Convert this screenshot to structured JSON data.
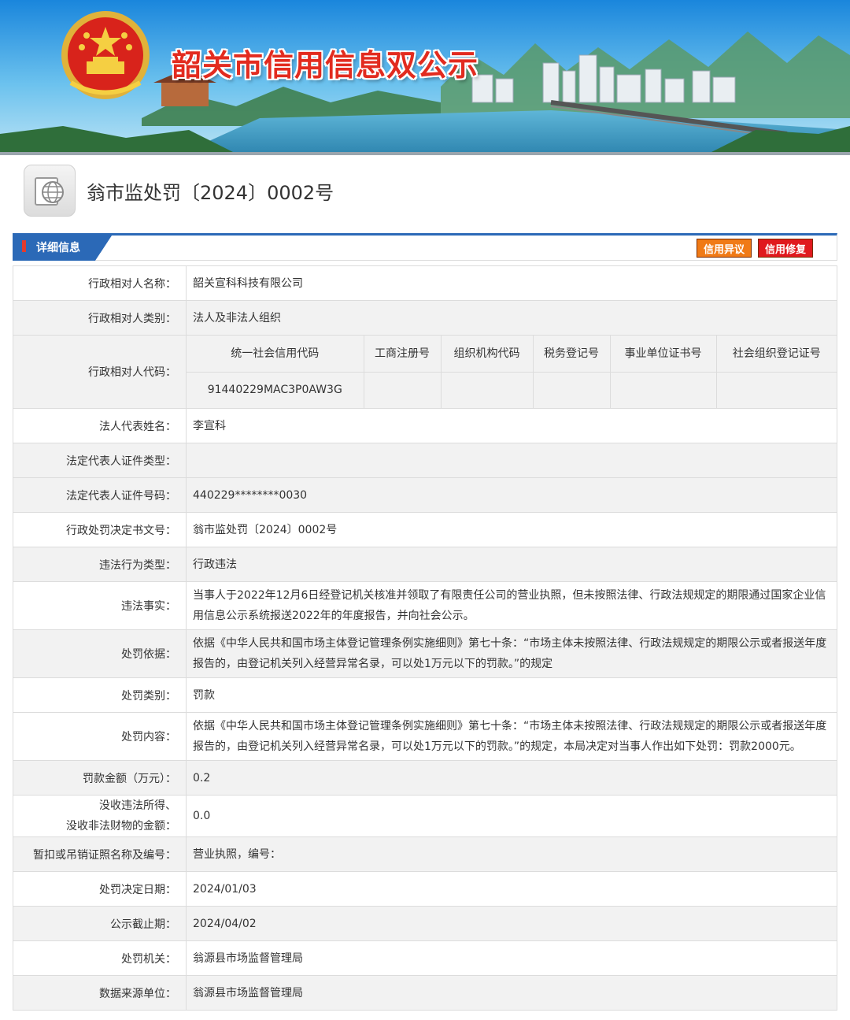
{
  "banner": {
    "title": "韶关市信用信息双公示"
  },
  "doc": {
    "title": "翁市监处罚〔2024〕0002号"
  },
  "section": {
    "tab_label": "详细信息",
    "objection_button": "信用异议",
    "repair_button": "信用修复"
  },
  "rows": {
    "name": {
      "label": "行政相对人名称：",
      "value": "韶关宣科科技有限公司"
    },
    "category": {
      "label": "行政相对人类别：",
      "value": "法人及非法人组织"
    },
    "code": {
      "label": "行政相对人代码：",
      "headers": [
        "统一社会信用代码",
        "工商注册号",
        "组织机构代码",
        "税务登记号",
        "事业单位证书号",
        "社会组织登记证号"
      ],
      "values": [
        "91440229MAC3P0AW3G",
        "",
        "",
        "",
        "",
        ""
      ]
    },
    "legal_rep": {
      "label": "法人代表姓名：",
      "value": "李宣科"
    },
    "id_type": {
      "label": "法定代表人证件类型：",
      "value": ""
    },
    "id_number": {
      "label": "法定代表人证件号码：",
      "value": "440229********0030"
    },
    "decision_no": {
      "label": "行政处罚决定书文号：",
      "value": "翁市监处罚〔2024〕0002号"
    },
    "violation_type": {
      "label": "违法行为类型：",
      "value": "行政违法"
    },
    "violation_fact": {
      "label": "违法事实：",
      "value": "当事人于2022年12月6日经登记机关核准并领取了有限责任公司的营业执照，但未按照法律、行政法规规定的期限通过国家企业信用信息公示系统报送2022年的年度报告，并向社会公示。"
    },
    "basis": {
      "label": "处罚依据：",
      "value": "依据《中华人民共和国市场主体登记管理条例实施细则》第七十条：“市场主体未按照法律、行政法规规定的期限公示或者报送年度报告的，由登记机关列入经营异常名录，可以处1万元以下的罚款。”的规定"
    },
    "penalty_type": {
      "label": "处罚类别：",
      "value": "罚款"
    },
    "penalty_content": {
      "label": "处罚内容：",
      "value": "依据《中华人民共和国市场主体登记管理条例实施细则》第七十条：“市场主体未按照法律、行政法规规定的期限公示或者报送年度报告的，由登记机关列入经营异常名录，可以处1万元以下的罚款。”的规定，本局决定对当事人作出如下处罚：罚款2000元。"
    },
    "fine": {
      "label": "罚款金额（万元）：",
      "value": "0.2"
    },
    "confiscation": {
      "label_line1": "没收违法所得、",
      "label_line2": "没收非法财物的金额：",
      "value": "0.0"
    },
    "license": {
      "label": "暂扣或吊销证照名称及编号：",
      "value": "营业执照，编号："
    },
    "decision_date": {
      "label": "处罚决定日期：",
      "value": "2024/01/03"
    },
    "publicity_end": {
      "label": "公示截止期：",
      "value": "2024/04/02"
    },
    "authority": {
      "label": "处罚机关：",
      "value": "翁源县市场监督管理局"
    },
    "data_source": {
      "label": "数据来源单位：",
      "value": "翁源县市场监督管理局"
    }
  }
}
